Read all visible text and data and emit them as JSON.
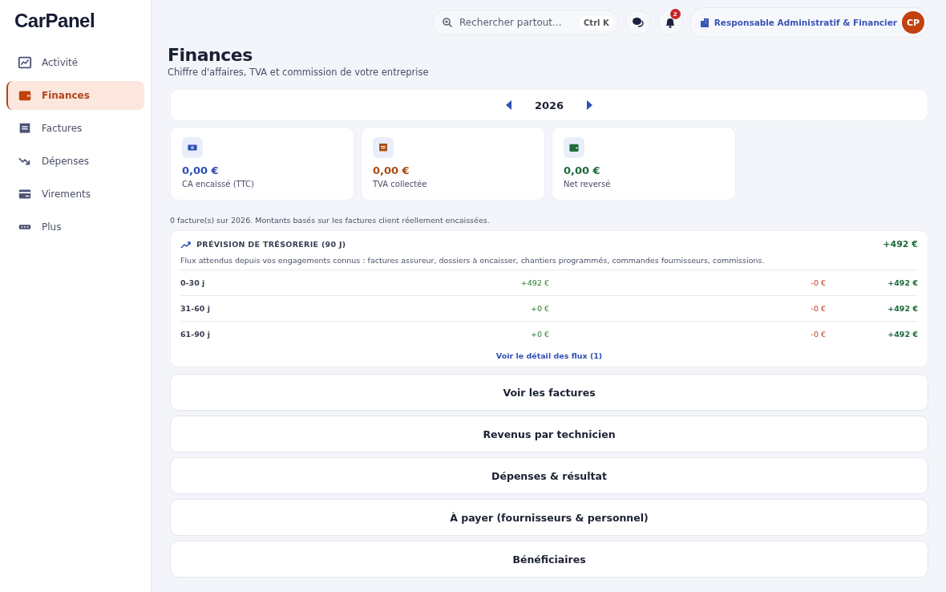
{
  "logo": {
    "text": "CarPanel"
  },
  "sidebar": {
    "items": [
      {
        "label": "Activité",
        "kind": "chart",
        "selected": false
      },
      {
        "label": "Finances",
        "kind": "wallet",
        "selected": true
      },
      {
        "label": "Factures",
        "kind": "receipt",
        "selected": false
      },
      {
        "label": "Dépenses",
        "kind": "trend-down",
        "selected": false
      },
      {
        "label": "Virements",
        "kind": "card",
        "selected": false
      },
      {
        "label": "Plus",
        "kind": "dots",
        "selected": false
      }
    ]
  },
  "topbar": {
    "search": {
      "placeholder": "Rechercher partout...",
      "shortcut": "Ctrl K"
    },
    "notifications": "2",
    "role": "Responsable Administratif & Financier",
    "avatar": "CP"
  },
  "page": {
    "title": "Finances",
    "subtitle": "Chiffre d'affaires, TVA et commission de votre entreprise"
  },
  "year": {
    "label": "2026"
  },
  "stats": [
    {
      "value": "0,00 €",
      "label": "CA encaissé (TTC)",
      "kind": "money",
      "color": "#2f4fb5"
    },
    {
      "value": "0,00 €",
      "label": "TVA collectée",
      "kind": "receipt",
      "color": "#a84a10"
    },
    {
      "value": "0,00 €",
      "label": "Net reversé",
      "kind": "wallet",
      "color": "#1e6b3a"
    }
  ],
  "note": "0 facture(s) sur 2026. Montants basés sur les factures client réellement encaissées.",
  "forecast": {
    "title": "PRÉVISION DE TRÉSORERIE (90 J)",
    "total": "+492 €",
    "description": "Flux attendus depuis vos engagements connus : factures assureur, dossiers à encaisser, chantiers programmés, commandes fournisseurs, commissions.",
    "rows": [
      {
        "period": "0-30 j",
        "income": "+492 €",
        "expense": "-0 €",
        "net": "+492 €"
      },
      {
        "period": "31-60 j",
        "income": "+0 €",
        "expense": "-0 €",
        "net": "+492 €"
      },
      {
        "period": "61-90 j",
        "income": "+0 €",
        "expense": "-0 €",
        "net": "+492 €"
      }
    ],
    "link": "Voir le détail des flux (1)"
  },
  "sections": [
    "Voir les factures",
    "Revenus par technicien",
    "Dépenses & résultat",
    "À payer (fournisseurs & personnel)",
    "Bénéficiaires"
  ]
}
